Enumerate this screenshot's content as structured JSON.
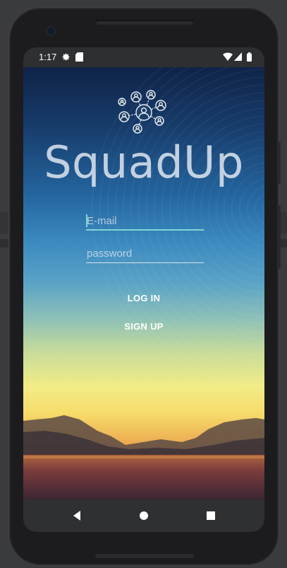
{
  "statusbar": {
    "time": "1:17",
    "icons": [
      "settings-icon",
      "sd-card-icon",
      "wifi-icon",
      "signal-icon",
      "battery-icon"
    ]
  },
  "app": {
    "brand": "SquadUp",
    "logo_icon": "people-network-icon",
    "email": {
      "value": "",
      "placeholder": "E-mail"
    },
    "password": {
      "value": "",
      "placeholder": "password"
    },
    "login_label": "LOG IN",
    "signup_label": "SIGN UP",
    "colors": {
      "accent": "#7fd8d2",
      "sky_top": "#0f2348",
      "sun": "#f2ec86"
    }
  },
  "navbar": {
    "items": [
      "back-icon",
      "home-icon",
      "recents-icon"
    ]
  }
}
